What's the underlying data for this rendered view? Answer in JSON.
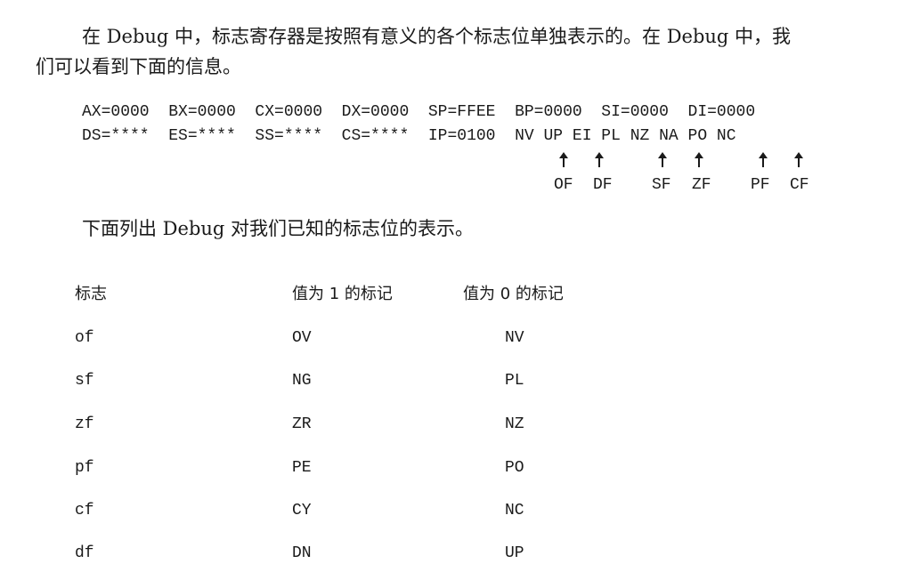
{
  "intro": {
    "line1": "在 Debug 中，标志寄存器是按照有意义的各个标志位单独表示的。在 Debug 中，我",
    "line2": "们可以看到下面的信息。"
  },
  "registers": {
    "line1": "AX=0000  BX=0000  CX=0000  DX=0000  SP=FFEE  BP=0000  SI=0000  DI=0000",
    "line2": "DS=****  ES=****  SS=****  CS=****  IP=0100  NV UP EI PL NZ NA PO NC"
  },
  "arrow_labels": [
    "OF",
    "DF",
    "SF",
    "ZF",
    "PF",
    "CF"
  ],
  "list_intro": "下面列出 Debug 对我们已知的标志位的表示。",
  "table": {
    "headers": [
      "标志",
      "值为 1 的标记",
      "值为 0 的标记"
    ],
    "rows": [
      [
        "of",
        "OV",
        "NV"
      ],
      [
        "sf",
        "NG",
        "PL"
      ],
      [
        "zf",
        "ZR",
        "NZ"
      ],
      [
        "pf",
        "PE",
        "PO"
      ],
      [
        "cf",
        "CY",
        "NC"
      ],
      [
        "df",
        "DN",
        "UP"
      ]
    ]
  }
}
